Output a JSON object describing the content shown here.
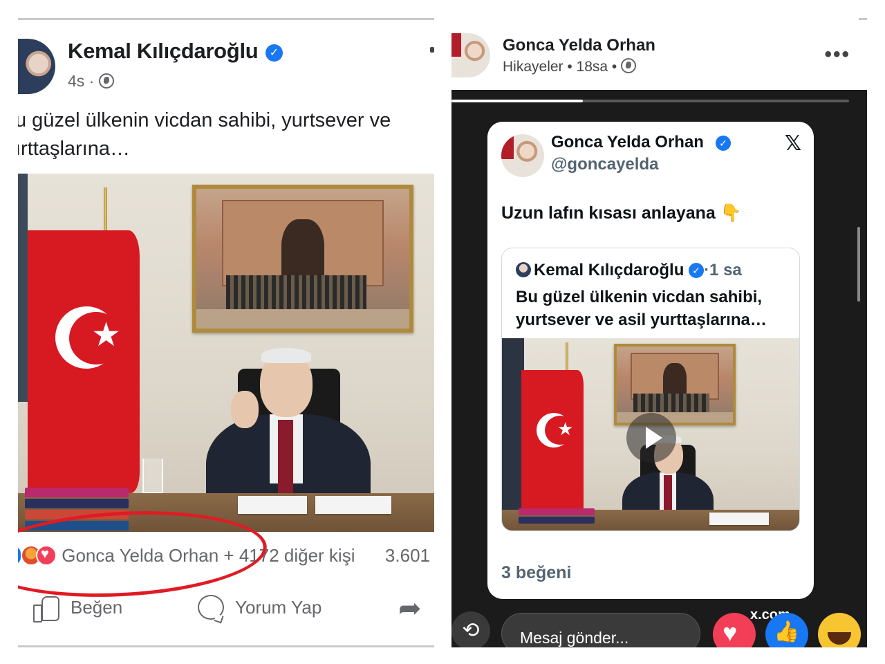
{
  "left_post": {
    "author": "Kemal Kılıçdaroğlu",
    "verified_badge": "✓",
    "time": "4s",
    "meta_sep": "·",
    "text": "u güzel ülkenin vicdan sahibi, yurtsever ve\nırttaşlarına…",
    "reactions_text": "Gonca Yelda Orhan + 4172 diğer kişi",
    "reaction_count": "3.601",
    "actions": {
      "like": "Beğen",
      "comment": "Yorum Yap"
    },
    "icons": [
      "globe-icon",
      "like-icon",
      "comment-icon",
      "share-icon"
    ],
    "highlight_color": "#e01b24"
  },
  "right_story": {
    "author": "Gonca Yelda Orhan",
    "meta": "Hikayeler • 18sa •",
    "more": "•••",
    "progress": 0.33,
    "tweet": {
      "name": "Gonca Yelda Orhan",
      "handle": "@goncayelda",
      "x_logo": "𝕏",
      "text": "Uzun lafın kısası anlayana",
      "emoji": "👇",
      "quote": {
        "author": "Kemal Kılıçdaroğlu",
        "time": "·1 sa",
        "text": "Bu güzel ülkenin vicdan sahibi,\nyurtsever ve asil yurttaşlarına…"
      },
      "likes": "3 beğeni"
    },
    "bottom": {
      "message_placeholder": "Mesaj gönder...",
      "link": "x.com",
      "repost_icon": "⟲"
    },
    "accent": "#1877f2"
  }
}
